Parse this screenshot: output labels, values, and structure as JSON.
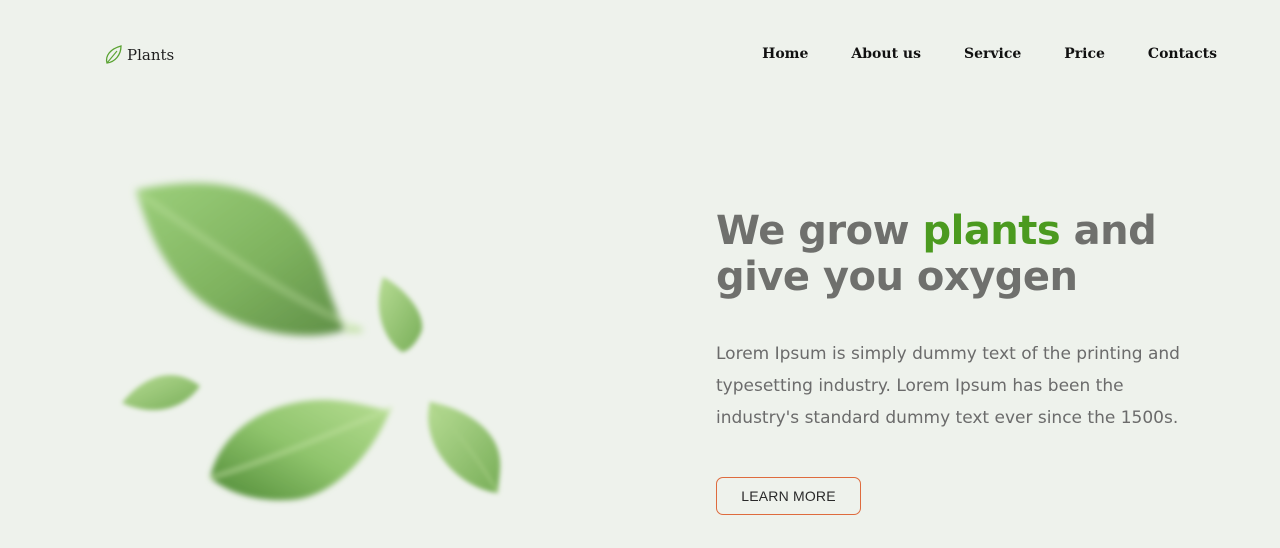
{
  "brand": {
    "name": "Plants",
    "icon": "leaf-icon"
  },
  "nav": {
    "items": [
      {
        "label": "Home"
      },
      {
        "label": "About us"
      },
      {
        "label": "Service"
      },
      {
        "label": "Price"
      },
      {
        "label": "Contacts"
      }
    ]
  },
  "hero": {
    "title_before": "We grow ",
    "title_accent": "plants",
    "title_after": " and give you oxygen",
    "description": "Lorem Ipsum is simply dummy text of the printing and typesetting industry. Lorem Ipsum has been the industry's standard dummy text ever since the 1500s.",
    "cta_label": "LEARN MORE",
    "image": "blurred-falling-leaves"
  },
  "colors": {
    "background": "#eef2ec",
    "accent": "#4b9a1f",
    "heading": "#6f706d",
    "body_text": "#6b6b6b",
    "button_border": "#de6b3e"
  }
}
